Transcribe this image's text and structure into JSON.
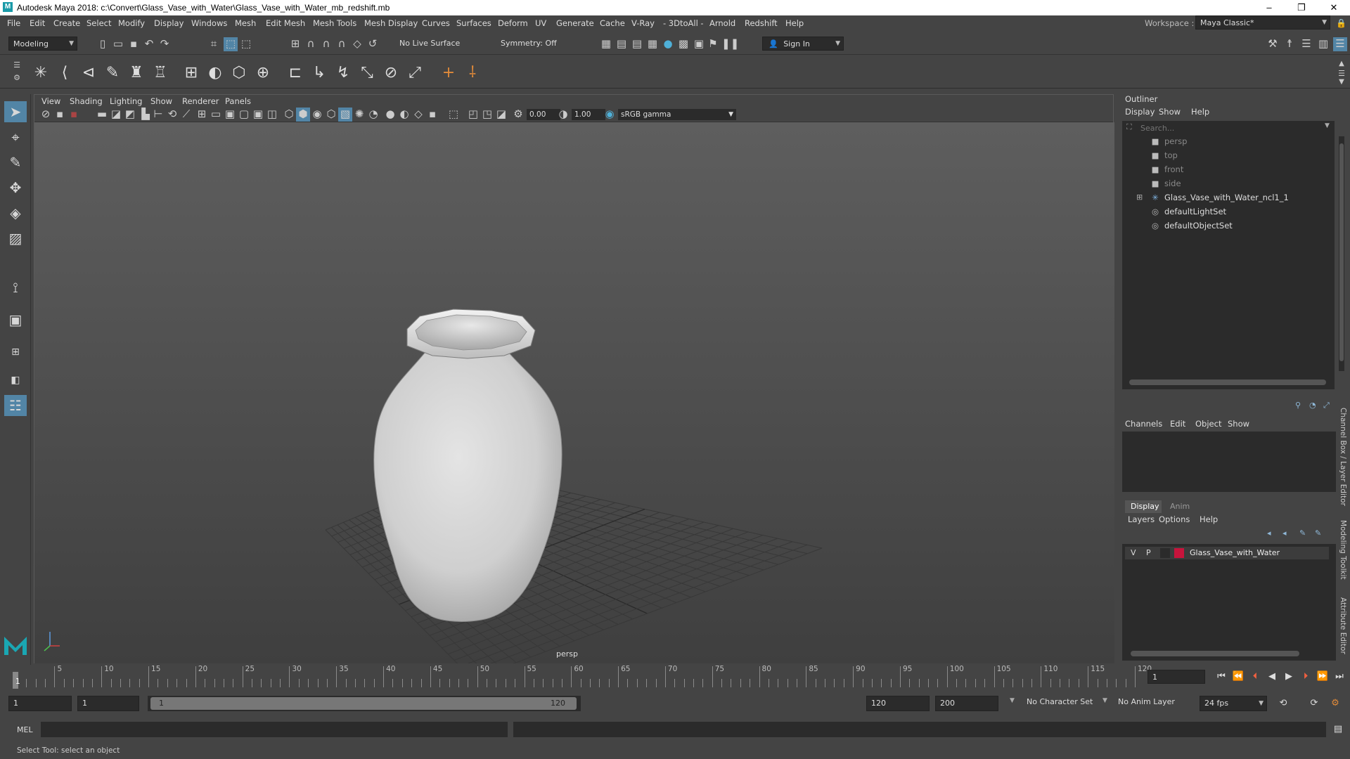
{
  "window": {
    "title": "Autodesk Maya 2018: c:\\Convert\\Glass_Vase_with_Water\\Glass_Vase_with_Water_mb_redshift.mb",
    "logo": "M",
    "controls": [
      "–",
      "❐",
      "✕"
    ]
  },
  "menubar": {
    "items": [
      "File",
      "Edit",
      "Create",
      "Select",
      "Modify",
      "Display",
      "Windows",
      "Mesh",
      "Edit Mesh",
      "Mesh Tools",
      "Mesh Display",
      "Curves",
      "Surfaces",
      "Deform",
      "UV",
      "Generate",
      "Cache",
      "V-Ray",
      "- 3DtoAll -",
      "Arnold",
      "Redshift",
      "Help"
    ],
    "workspace_label": "Workspace :",
    "workspace_value": "Maya Classic*"
  },
  "statusline": {
    "mode": "Modeling",
    "live_surface": "No Live Surface",
    "symmetry": "Symmetry: Off",
    "sign_in": "Sign In"
  },
  "viewport": {
    "menu": [
      "View",
      "Shading",
      "Lighting",
      "Show",
      "Renderer",
      "Panels"
    ],
    "exposure": "0.00",
    "gamma": "1.00",
    "colorspace": "sRGB gamma",
    "camera_label": "persp"
  },
  "outliner": {
    "title": "Outliner",
    "menu": [
      "Display",
      "Show",
      "Help"
    ],
    "search_placeholder": "Search...",
    "items": [
      {
        "label": "persp",
        "icon": "camera-icon",
        "dim": true
      },
      {
        "label": "top",
        "icon": "camera-icon",
        "dim": true
      },
      {
        "label": "front",
        "icon": "camera-icon",
        "dim": true
      },
      {
        "label": "side",
        "icon": "camera-icon",
        "dim": true
      },
      {
        "label": "Glass_Vase_with_Water_ncl1_1",
        "icon": "group-icon",
        "dim": false
      },
      {
        "label": "defaultLightSet",
        "icon": "set-icon",
        "dim": false
      },
      {
        "label": "defaultObjectSet",
        "icon": "set-icon",
        "dim": false
      }
    ]
  },
  "channelbox": {
    "menu": [
      "Channels",
      "Edit",
      "Object",
      "Show"
    ]
  },
  "layereditor": {
    "tabs": [
      "Display",
      "Anim"
    ],
    "menu": [
      "Layers",
      "Options",
      "Help"
    ],
    "layer": {
      "v": "V",
      "p": "P",
      "name": "Glass_Vase_with_Water",
      "color": "#c8143c"
    }
  },
  "side_tabs": [
    "Channel Box / Layer Editor",
    "Modeling Toolkit",
    "Attribute Editor"
  ],
  "timeline": {
    "start": 1,
    "end": 120,
    "ticks": [
      5,
      10,
      15,
      20,
      25,
      30,
      35,
      40,
      45,
      50,
      55,
      60,
      65,
      70,
      75,
      80,
      85,
      90,
      95,
      100,
      105,
      110,
      115,
      120
    ],
    "current_frame": "1",
    "current_marker": "1"
  },
  "range": {
    "start_field": "1",
    "playback_start": "1",
    "slider_start": "1",
    "slider_end": "120",
    "playback_end": "120",
    "end_field": "200",
    "character_set": "No Character Set",
    "anim_layer": "No Anim Layer",
    "fps": "24 fps"
  },
  "command": {
    "language": "MEL"
  },
  "helpline": {
    "text": "Select Tool: select an object"
  },
  "colors": {
    "accent": "#5285a6",
    "maya_logo": "#1aa7b3",
    "layer_color": "#c8143c"
  }
}
